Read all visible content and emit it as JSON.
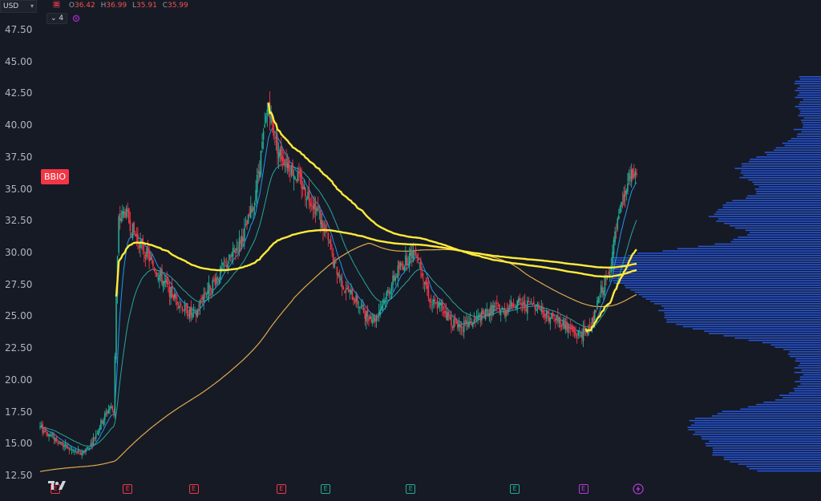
{
  "header": {
    "currency": "USD",
    "ohlc": [
      {
        "label": "O",
        "value": "36.42"
      },
      {
        "label": "H",
        "value": "36.99"
      },
      {
        "label": "L",
        "value": "35.91"
      },
      {
        "label": "C",
        "value": "35.99"
      }
    ],
    "collapse_count": "4"
  },
  "ticker": "BBIO",
  "colors": {
    "background": "#161a25",
    "up": "#22ab94",
    "down": "#f23645",
    "ema_fast": "#2196f3",
    "ema_slow": "#26a69a",
    "ma_long": "#e0a94b",
    "vwap": "#ffeb3b",
    "volume_profile": "#2962ff"
  },
  "chart_data": {
    "type": "candlestick",
    "y_axis": {
      "ticks": [
        "47.50",
        "45.00",
        "42.50",
        "40.00",
        "37.50",
        "35.00",
        "32.50",
        "30.00",
        "27.50",
        "25.00",
        "22.50",
        "20.00",
        "17.50",
        "15.00",
        "12.50"
      ],
      "ylim": [
        12.5,
        48.5
      ],
      "position": "left"
    },
    "price_path": [
      [
        0,
        16.2
      ],
      [
        12,
        15.4
      ],
      [
        22,
        14.6
      ],
      [
        32,
        14.2
      ],
      [
        40,
        14.9
      ],
      [
        48,
        16.6
      ],
      [
        55,
        17.9
      ],
      [
        58,
        17.5
      ],
      [
        60,
        26.5
      ],
      [
        62,
        32.5
      ],
      [
        67,
        33.2
      ],
      [
        74,
        31.5
      ],
      [
        82,
        30.2
      ],
      [
        90,
        28.8
      ],
      [
        98,
        27.6
      ],
      [
        106,
        26.4
      ],
      [
        114,
        25.6
      ],
      [
        122,
        24.9
      ],
      [
        128,
        26.6
      ],
      [
        136,
        27.6
      ],
      [
        144,
        28.7
      ],
      [
        154,
        30.2
      ],
      [
        162,
        31.8
      ],
      [
        168,
        33.8
      ],
      [
        172,
        36.3
      ],
      [
        176,
        39.0
      ],
      [
        180,
        41.8
      ],
      [
        184,
        39.5
      ],
      [
        188,
        37.9
      ],
      [
        194,
        37.1
      ],
      [
        202,
        36.0
      ],
      [
        210,
        34.7
      ],
      [
        218,
        33.4
      ],
      [
        226,
        31.2
      ],
      [
        232,
        29.0
      ],
      [
        240,
        27.2
      ],
      [
        248,
        26.4
      ],
      [
        256,
        25.2
      ],
      [
        264,
        24.8
      ],
      [
        272,
        26.5
      ],
      [
        282,
        28.6
      ],
      [
        290,
        29.6
      ],
      [
        296,
        30.3
      ],
      [
        302,
        28.2
      ],
      [
        308,
        26.0
      ],
      [
        316,
        25.8
      ],
      [
        324,
        24.6
      ],
      [
        334,
        24.2
      ],
      [
        342,
        24.6
      ],
      [
        350,
        25.1
      ],
      [
        358,
        25.7
      ],
      [
        366,
        25.4
      ],
      [
        374,
        26.1
      ],
      [
        382,
        25.8
      ],
      [
        390,
        26.0
      ],
      [
        398,
        25.2
      ],
      [
        408,
        24.7
      ],
      [
        416,
        24.1
      ],
      [
        422,
        23.6
      ],
      [
        430,
        23.7
      ],
      [
        436,
        24.7
      ],
      [
        442,
        27.0
      ],
      [
        448,
        28.2
      ],
      [
        453,
        31.2
      ],
      [
        458,
        33.5
      ],
      [
        464,
        35.7
      ],
      [
        470,
        36.2
      ]
    ],
    "days": 470,
    "series": [
      {
        "name": "",
        "style": "ema-fast"
      },
      {
        "name": "",
        "style": "ema-slow"
      },
      {
        "name": "",
        "style": "ma-long"
      },
      {
        "name": "",
        "style": "anchored-vwap"
      }
    ],
    "volume_profile": {
      "side": "right",
      "peaks": [
        {
          "price": 29.0,
          "strength": 1.0
        },
        {
          "price": 26.8,
          "strength": 0.55
        },
        {
          "price": 24.5,
          "strength": 0.55
        },
        {
          "price": 33.0,
          "strength": 0.42
        },
        {
          "price": 36.5,
          "strength": 0.3
        },
        {
          "price": 16.5,
          "strength": 0.5
        },
        {
          "price": 14.0,
          "strength": 0.35
        }
      ]
    },
    "events": [
      {
        "day": 12,
        "kind": "E",
        "tone": "red"
      },
      {
        "day": 69,
        "kind": "E",
        "tone": "red"
      },
      {
        "day": 121,
        "kind": "E",
        "tone": "red"
      },
      {
        "day": 190,
        "kind": "E",
        "tone": "red"
      },
      {
        "day": 225,
        "kind": "E",
        "tone": "green"
      },
      {
        "day": 292,
        "kind": "E",
        "tone": "green"
      },
      {
        "day": 374,
        "kind": "E",
        "tone": "green"
      },
      {
        "day": 428,
        "kind": "E",
        "tone": "purple"
      }
    ]
  }
}
